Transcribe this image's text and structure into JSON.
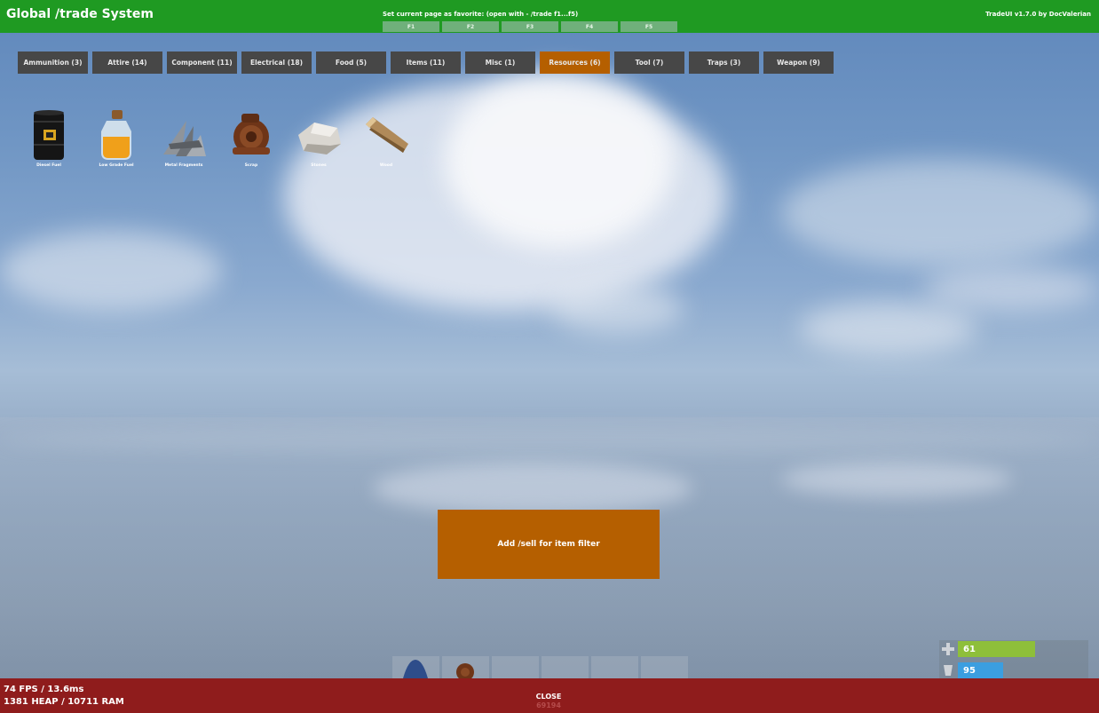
{
  "header": {
    "title": "Global /trade System",
    "favorite_hint": "Set current page as favorite: (open with - /trade f1...f5)",
    "favorite_slots": [
      "F1",
      "F2",
      "F3",
      "F4",
      "F5"
    ],
    "version": "TradeUI v1.7.0 by DocValerian"
  },
  "categories": [
    {
      "label": "Ammunition (3)"
    },
    {
      "label": "Attire (14)"
    },
    {
      "label": "Component (11)"
    },
    {
      "label": "Electrical (18)"
    },
    {
      "label": "Food (5)"
    },
    {
      "label": "Items (11)"
    },
    {
      "label": "Misc (1)"
    },
    {
      "label": "Resources (6)",
      "active": true
    },
    {
      "label": "Tool (7)"
    },
    {
      "label": "Traps (3)"
    },
    {
      "label": "Weapon (9)"
    }
  ],
  "items": [
    {
      "label": "Diesel Fuel",
      "icon": "diesel-barrel-icon"
    },
    {
      "label": "Low Grade Fuel",
      "icon": "fuel-jar-icon"
    },
    {
      "label": "Metal Fragments",
      "icon": "metal-fragments-icon"
    },
    {
      "label": "Scrap",
      "icon": "scrap-icon"
    },
    {
      "label": "Stones",
      "icon": "stone-icon"
    },
    {
      "label": "Wood",
      "icon": "wood-icon"
    }
  ],
  "center_action": {
    "label": "Add /sell for item filter"
  },
  "status": {
    "health": "61",
    "water": "95",
    "health_color": "#8ebf3a",
    "water_color": "#3b9ee0",
    "health_fraction": 0.61,
    "water_fraction": 0.36
  },
  "footer": {
    "perf_line1": "74 FPS / 13.6ms",
    "perf_line2": "1381 HEAP / 10711 RAM",
    "close_label": "CLOSE",
    "coins": "69194"
  },
  "colors": {
    "header_green": "#1f9a22",
    "tab_gray": "#474747",
    "accent_orange": "#b55f00",
    "footer_red": "#8f1c1c"
  }
}
